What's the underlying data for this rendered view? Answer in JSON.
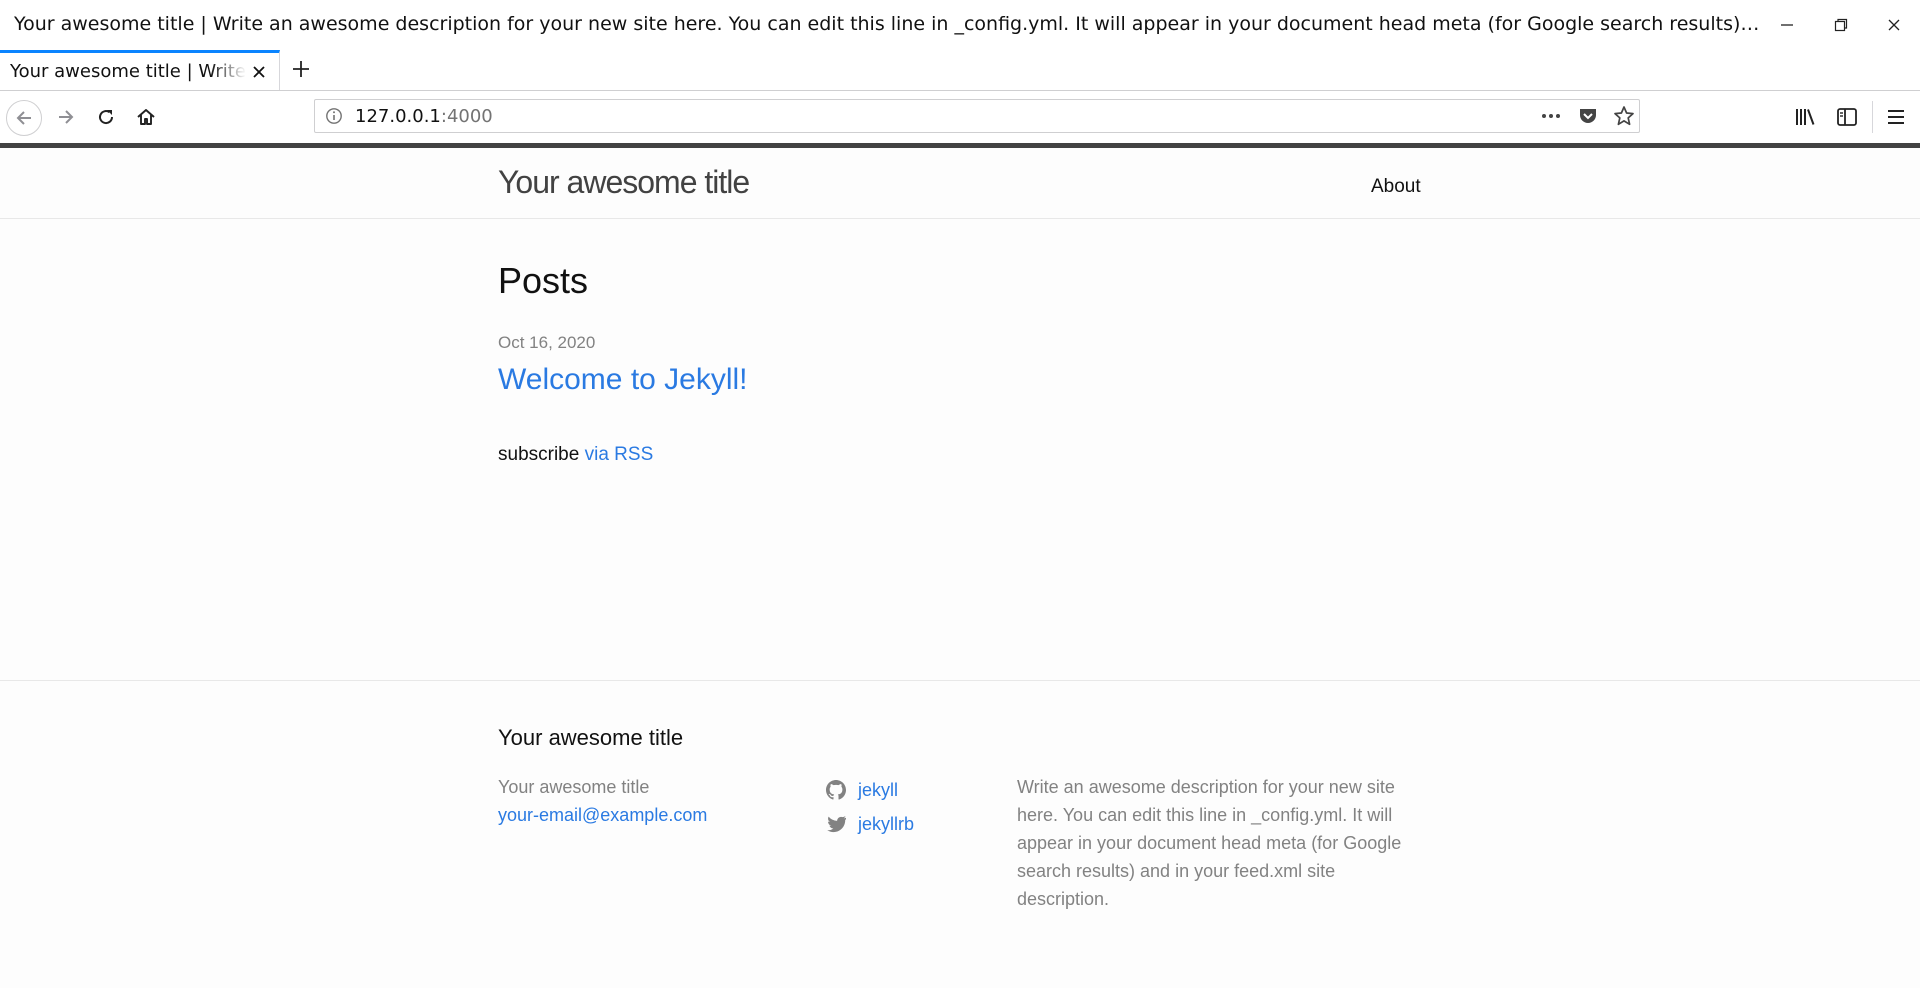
{
  "window": {
    "title": "Your awesome title | Write an awesome description for your new site here. You can edit this line in _config.yml. It will appear in your document head meta (for Google search results) and in your feed.xml site description."
  },
  "tab": {
    "title": "Your awesome title | Write an awesome description for your new site here."
  },
  "urlbar": {
    "host": "127.0.0.1",
    "port": ":4000"
  },
  "site": {
    "title": "Your awesome title",
    "nav": {
      "about": "About"
    }
  },
  "main": {
    "heading": "Posts",
    "posts": [
      {
        "date": "Oct 16, 2020",
        "title": "Welcome to Jekyll!"
      }
    ],
    "subscribe_text": "subscribe",
    "rss_link": "via RSS"
  },
  "footer": {
    "heading": "Your awesome title",
    "name": "Your awesome title",
    "email": "your-email@example.com",
    "github": "jekyll",
    "twitter": "jekyllrb",
    "description": "Write an awesome description for your new site here. You can edit this line in _config.yml. It will appear in your document head meta (for Google search results) and in your feed.xml site description."
  },
  "colors": {
    "link": "#2a7ae2",
    "tab_accent": "#0a84ff",
    "muted_text": "#828282",
    "header_border": "#424242"
  },
  "icons": [
    "close-icon",
    "minimize-icon",
    "restore-icon",
    "plus-icon",
    "back-arrow-icon",
    "forward-arrow-icon",
    "reload-icon",
    "home-icon",
    "info-icon",
    "more-icon",
    "pocket-icon",
    "star-icon",
    "library-icon",
    "sidebar-icon",
    "menu-icon",
    "github-icon",
    "twitter-icon"
  ]
}
